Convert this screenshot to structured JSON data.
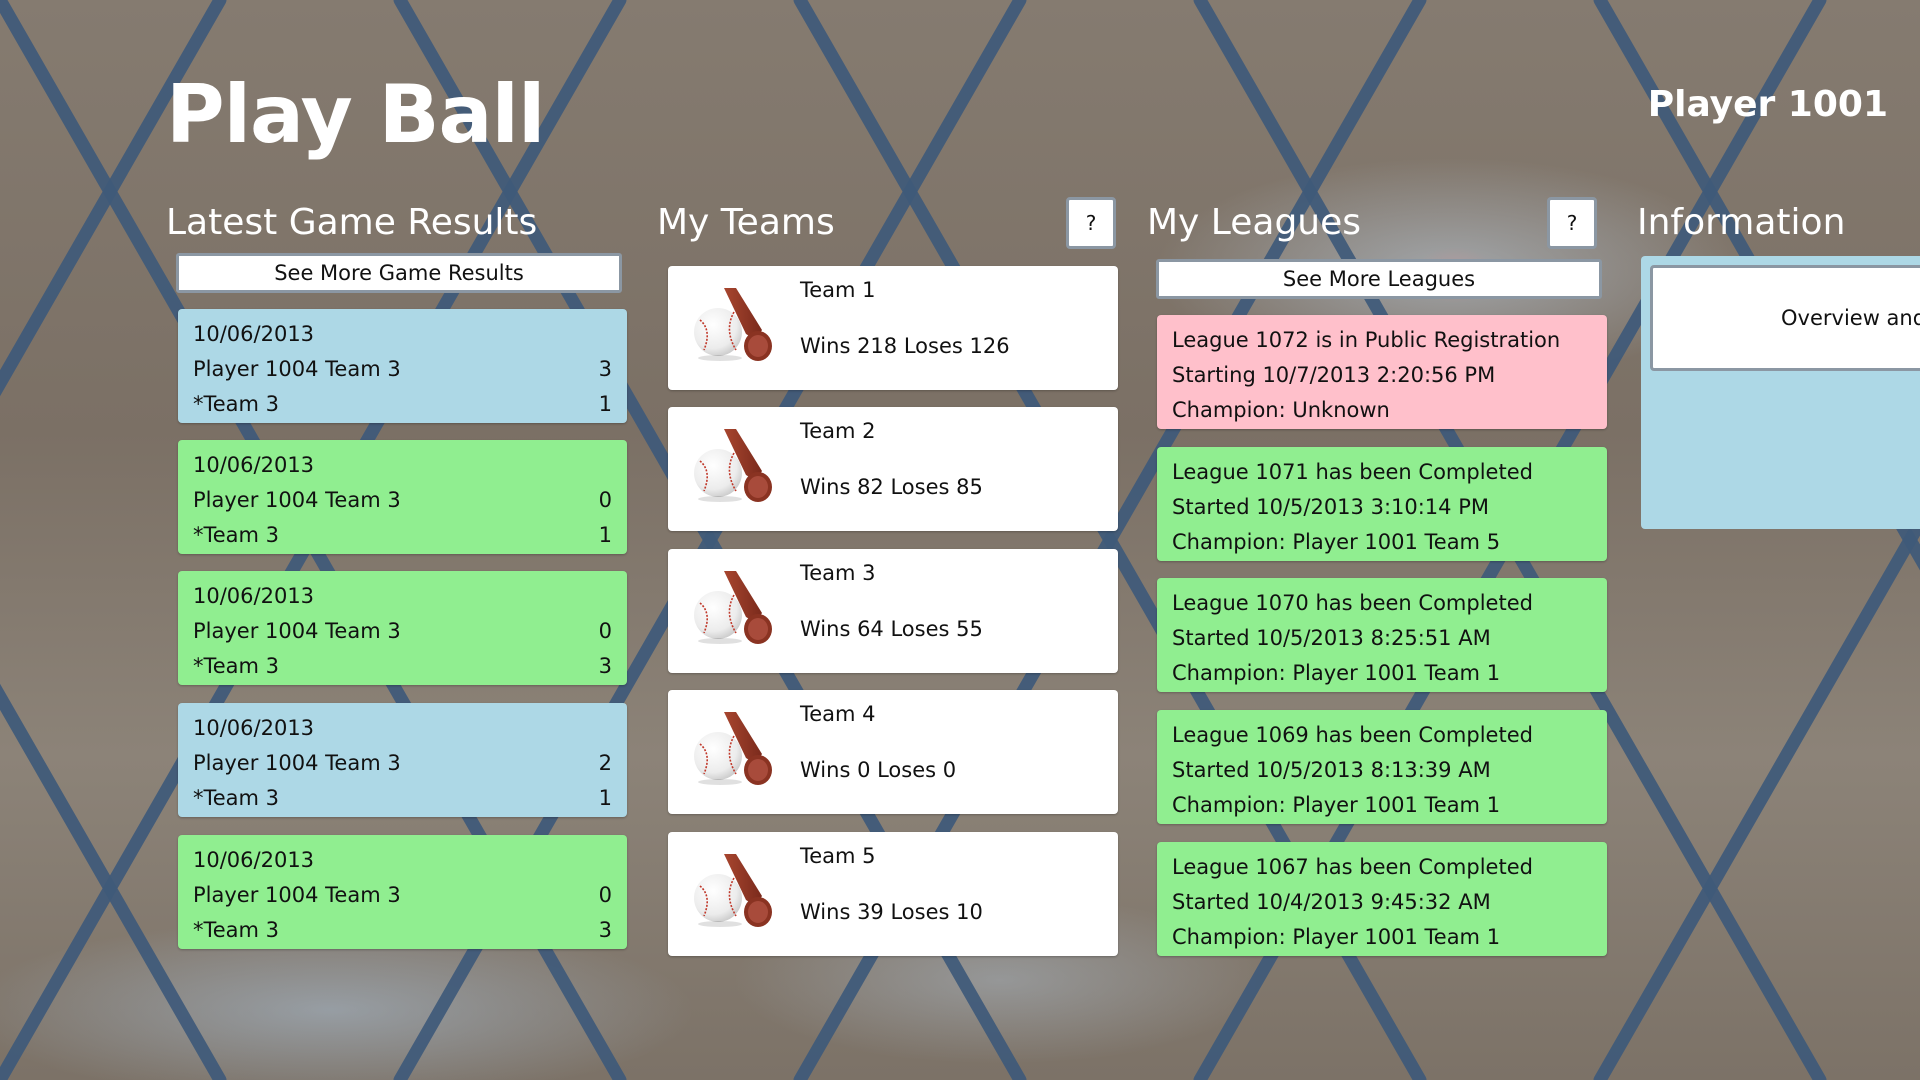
{
  "app": {
    "title": "Play Ball",
    "user": "Player 1001"
  },
  "colors": {
    "win": "#90ee90",
    "loss": "#add8e6",
    "registration": "#ffc0cb",
    "card": "#ffffff"
  },
  "games": {
    "header": "Latest Game Results",
    "see_more": "See More Game Results",
    "items": [
      {
        "date": "10/06/2013",
        "team_a": "Player 1004 Team 3",
        "score_a": "3",
        "team_b": "*Team 3",
        "score_b": "1",
        "status": "loss"
      },
      {
        "date": "10/06/2013",
        "team_a": "Player 1004 Team 3",
        "score_a": "0",
        "team_b": "*Team 3",
        "score_b": "1",
        "status": "win"
      },
      {
        "date": "10/06/2013",
        "team_a": "Player 1004 Team 3",
        "score_a": "0",
        "team_b": "*Team 3",
        "score_b": "3",
        "status": "win"
      },
      {
        "date": "10/06/2013",
        "team_a": "Player 1004 Team 3",
        "score_a": "2",
        "team_b": "*Team 3",
        "score_b": "1",
        "status": "loss"
      },
      {
        "date": "10/06/2013",
        "team_a": "Player 1004 Team 3",
        "score_a": "0",
        "team_b": "*Team 3",
        "score_b": "3",
        "status": "win"
      }
    ]
  },
  "teams": {
    "header": "My Teams",
    "help": "?",
    "icon": "baseball-bat-icon",
    "items": [
      {
        "name": "Team 1",
        "record": "Wins 218 Loses 126"
      },
      {
        "name": "Team 2",
        "record": "Wins 82 Loses 85"
      },
      {
        "name": "Team 3",
        "record": "Wins 64 Loses 55"
      },
      {
        "name": "Team 4",
        "record": "Wins 0 Loses 0"
      },
      {
        "name": "Team 5",
        "record": "Wins 39 Loses 10"
      }
    ]
  },
  "leagues": {
    "header": "My Leagues",
    "help": "?",
    "see_more": "See More Leagues",
    "items": [
      {
        "status_text": "League 1072 is in Public Registration",
        "start": "Starting 10/7/2013 2:20:56 PM",
        "champion": "Champion: Unknown",
        "status": "registration"
      },
      {
        "status_text": "League 1071 has been Completed",
        "start": "Started 10/5/2013 3:10:14 PM",
        "champion": "Champion: Player 1001 Team 5",
        "status": "completed"
      },
      {
        "status_text": "League 1070 has been Completed",
        "start": "Started 10/5/2013 8:25:51 AM",
        "champion": "Champion: Player 1001 Team 1",
        "status": "completed"
      },
      {
        "status_text": "League 1069 has been Completed",
        "start": "Started 10/5/2013 8:13:39 AM",
        "champion": "Champion: Player 1001 Team 1",
        "status": "completed"
      },
      {
        "status_text": "League 1067 has been Completed",
        "start": "Started 10/4/2013 9:45:32 AM",
        "champion": "Champion: Player 1001 Team 1",
        "status": "completed"
      }
    ]
  },
  "information": {
    "header": "Information",
    "tile_label": "Overview and"
  }
}
